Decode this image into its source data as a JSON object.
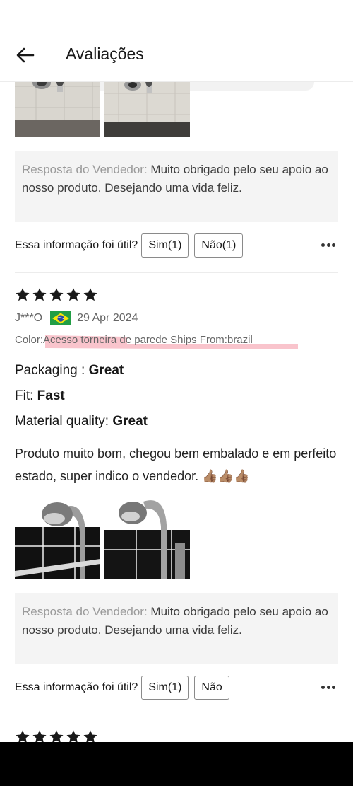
{
  "header": {
    "title": "Avaliações"
  },
  "reviews": [
    {
      "seller_reply": {
        "label": "Resposta do Vendedor:",
        "text": " Muito obrigado pelo seu apoio ao nosso produto. Desejando uma vida feliz."
      },
      "helpful": {
        "question": "Essa informação foi útil?",
        "yes_label": "Sim(1)",
        "no_label": "Não(1)"
      }
    },
    {
      "rating": 5,
      "reviewer": "J***O",
      "country": "brazil-flag",
      "date": "29 Apr 2024",
      "variant": "Color:Acesso  torneira de parede Ships From:brazil",
      "attributes": [
        {
          "label": "Packaging : ",
          "value": "Great"
        },
        {
          "label": "Fit: ",
          "value": "Fast"
        },
        {
          "label": "Material quality: ",
          "value": "Great"
        }
      ],
      "text": "Produto muito bom, chegou bem embalado e em perfeito estado, super indico o vendedor. 👍🏽👍🏽👍🏽",
      "seller_reply": {
        "label": "Resposta do Vendedor:",
        "text": " Muito obrigado pelo seu apoio ao nosso produto. Desejando uma vida feliz."
      },
      "helpful": {
        "question": "Essa informação foi útil?",
        "yes_label": "Sim(1)",
        "no_label": "Não"
      }
    },
    {
      "rating": 5
    }
  ],
  "colors": {
    "highlight": "#f06478",
    "star": "#191919",
    "reply_bg": "#f4f4f4"
  }
}
